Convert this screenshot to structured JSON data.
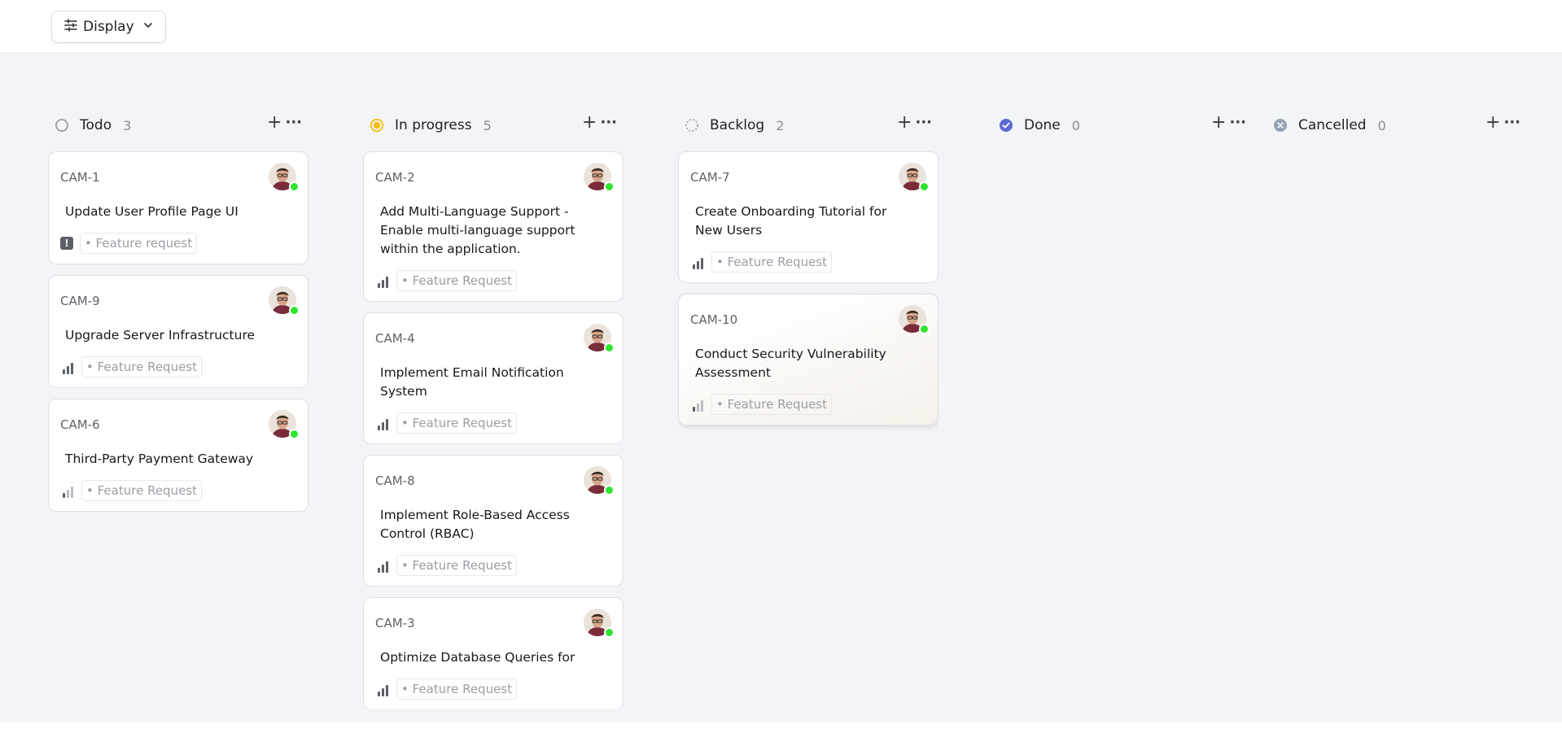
{
  "toolbar": {
    "display_label": "Display"
  },
  "columns": [
    {
      "title": "Todo",
      "count": "3",
      "status": "todo",
      "cards": [
        {
          "id": "CAM-1",
          "title": "Update User Profile Page UI",
          "priority": "urgent",
          "priority_glyph": "!",
          "tag": "• Feature request"
        },
        {
          "id": "CAM-9",
          "title": "Upgrade Server Infrastructure",
          "priority": "medium",
          "tag": "• Feature Request"
        },
        {
          "id": "CAM-6",
          "title": "Third-Party Payment Gateway",
          "priority": "low",
          "tag": "• Feature Request"
        }
      ]
    },
    {
      "title": "In progress",
      "count": "5",
      "status": "in-progress",
      "cards": [
        {
          "id": "CAM-2",
          "title": "Add Multi-Language Support - Enable multi-language support within the application.",
          "priority": "high",
          "tag": "• Feature Request"
        },
        {
          "id": "CAM-4",
          "title": "Implement Email Notification System",
          "priority": "high",
          "tag": "• Feature Request"
        },
        {
          "id": "CAM-8",
          "title": "Implement Role-Based Access Control (RBAC)",
          "priority": "high",
          "tag": "• Feature Request"
        },
        {
          "id": "CAM-3",
          "title": "Optimize Database Queries for",
          "priority": "high",
          "tag": "• Feature Request"
        }
      ]
    },
    {
      "title": "Backlog",
      "count": "2",
      "status": "backlog",
      "cards": [
        {
          "id": "CAM-7",
          "title": "Create Onboarding Tutorial for New Users",
          "priority": "medium",
          "tag": "• Feature Request"
        },
        {
          "id": "CAM-10",
          "title": "Conduct Security Vulnerability Assessment",
          "priority": "low",
          "tag": "• Feature Request",
          "hover": true
        }
      ]
    },
    {
      "title": "Done",
      "count": "0",
      "status": "done",
      "cards": []
    },
    {
      "title": "Cancelled",
      "count": "0",
      "status": "cancelled",
      "cards": []
    }
  ],
  "colors": {
    "board_bg": "#f3f4f7",
    "in_progress": "#f2c00c",
    "done": "#5e6ad2",
    "cancelled": "#95a2b3",
    "online": "#2ee52e"
  },
  "icons": {
    "display": "sliders-icon",
    "chevron": "chevron-down-icon",
    "add": "plus-icon",
    "more": "more-horizontal-icon"
  }
}
